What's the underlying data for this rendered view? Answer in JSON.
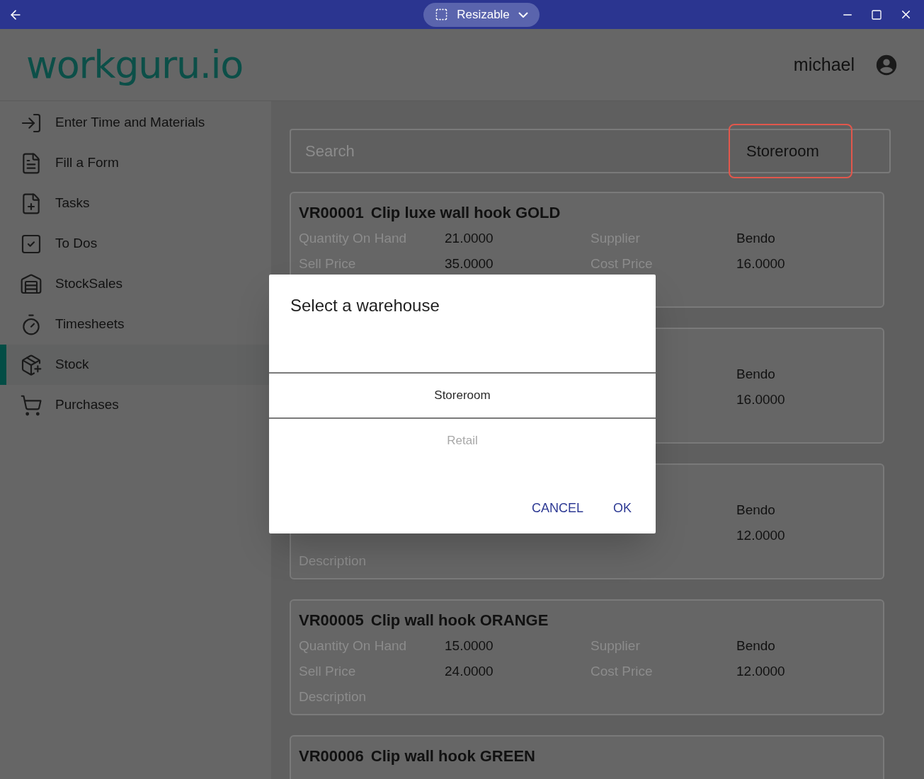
{
  "title_bar": {
    "mode_label": "Resizable"
  },
  "header": {
    "logo": "workguru.io",
    "user": "michael"
  },
  "sidebar": {
    "items": [
      {
        "label": "Enter Time and Materials",
        "selected": false
      },
      {
        "label": "Fill a Form",
        "selected": false
      },
      {
        "label": "Tasks",
        "selected": false
      },
      {
        "label": "To Dos",
        "selected": false
      },
      {
        "label": "StockSales",
        "selected": false
      },
      {
        "label": "Timesheets",
        "selected": false
      },
      {
        "label": "Stock",
        "selected": true
      },
      {
        "label": "Purchases",
        "selected": false
      }
    ]
  },
  "search": {
    "placeholder": "Search",
    "warehouse": "Storeroom"
  },
  "products": [
    {
      "code": "VR00001",
      "name": "Clip luxe wall hook GOLD",
      "rows": [
        {
          "label_1": "Quantity On Hand",
          "value_1": "21.0000",
          "label_2": "Supplier",
          "value_2": "Bendo"
        },
        {
          "label_1": "Sell Price",
          "value_1": "35.0000",
          "label_2": "Cost Price",
          "value_2": "16.0000"
        },
        {}
      ]
    },
    {
      "rows": [
        {
          "value_2": "Bendo"
        },
        {
          "value_2": "16.0000"
        },
        {}
      ]
    },
    {
      "rows": [
        {
          "value_2": "Bendo"
        },
        {
          "value_2": "12.0000"
        },
        {
          "label_1": "Description"
        }
      ]
    },
    {
      "code": "VR00005",
      "name": "Clip wall hook ORANGE",
      "rows": [
        {
          "label_1": "Quantity On Hand",
          "value_1": "15.0000",
          "label_2": "Supplier",
          "value_2": "Bendo"
        },
        {
          "label_1": "Sell Price",
          "value_1": "24.0000",
          "label_2": "Cost Price",
          "value_2": "12.0000"
        },
        {
          "label_1": "Description"
        }
      ]
    },
    {
      "code": "VR00006",
      "name": "Clip wall hook GREEN",
      "rows": [
        {},
        {},
        {}
      ]
    }
  ],
  "dialog": {
    "title": "Select a warehouse",
    "options": [
      {
        "label": "Storeroom",
        "selected": true
      },
      {
        "label": "Retail",
        "selected": false
      }
    ],
    "buttons": [
      "CANCEL",
      "OK"
    ]
  }
}
